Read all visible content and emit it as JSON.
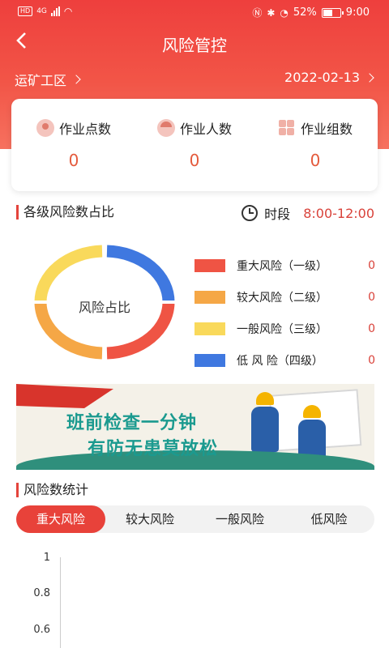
{
  "status_bar": {
    "left": "HD",
    "network": "4G",
    "battery_percent": "52%",
    "time": "9:00"
  },
  "header": {
    "title": "风险管控",
    "area": "运矿工区",
    "date": "2022-02-13"
  },
  "stats": [
    {
      "label": "作业点数",
      "value": "0",
      "icon": "location-pin-icon"
    },
    {
      "label": "作业人数",
      "value": "0",
      "icon": "worker-icon"
    },
    {
      "label": "作业组数",
      "value": "0",
      "icon": "group-icon"
    }
  ],
  "risk_ratio": {
    "title": "各级风险数占比",
    "period_label": "时段",
    "period_value": "8:00-12:00",
    "center_label": "风险占比",
    "legend": [
      {
        "label": "重大风险（一级）",
        "value": "0",
        "color": "#ef5444"
      },
      {
        "label": "较大风险（二级）",
        "value": "0",
        "color": "#f5a746"
      },
      {
        "label": "一般风险（三级）",
        "value": "0",
        "color": "#f9d95b"
      },
      {
        "label": "低  风 险（四级）",
        "value": "0",
        "color": "#3f78e0"
      }
    ]
  },
  "banner": {
    "line1": "班前检查一分钟",
    "line2": "有防无患莫放松"
  },
  "risk_stats": {
    "title": "风险数统计",
    "tabs": [
      "重大风险",
      "较大风险",
      "一般风险",
      "低风险"
    ],
    "active_tab": 0,
    "y_ticks": [
      "1",
      "0.8",
      "0.6"
    ]
  }
}
